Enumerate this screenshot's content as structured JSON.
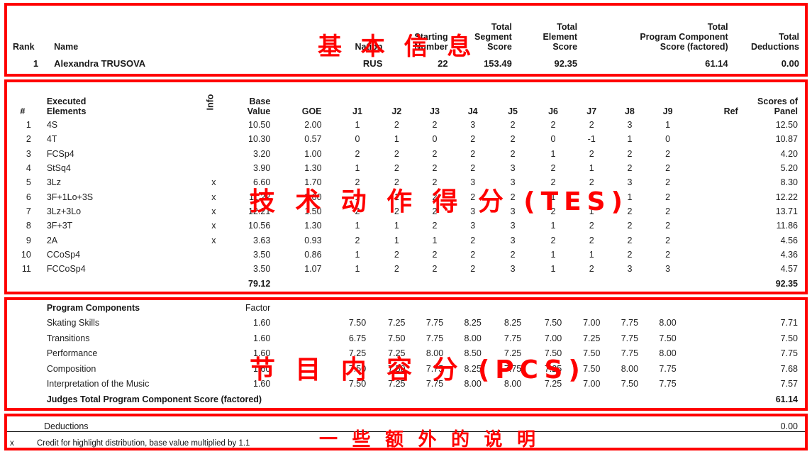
{
  "info": {
    "columns": {
      "rank": "Rank",
      "name": "Name",
      "nation": "Nation",
      "starting_number": [
        "Starting",
        "Number"
      ],
      "total_segment_score": [
        "Total",
        "Segment",
        "Score"
      ],
      "total_element_score": [
        "Total",
        "Element",
        "Score"
      ],
      "total_program_component_score": [
        "Total",
        "Program  Component",
        "Score (factored)"
      ],
      "total_deductions": [
        "Total",
        "Deductions"
      ]
    },
    "skater": {
      "rank": "1",
      "name": "Alexandra TRUSOVA",
      "nation": "RUS",
      "starting_number": "22",
      "total_segment_score": "153.49",
      "total_element_score": "92.35",
      "total_program_component_score": "61.14",
      "total_deductions": "0.00"
    }
  },
  "elements": {
    "columns": {
      "num": "#",
      "executed_elements": [
        "Executed",
        "Elements"
      ],
      "info": "Info",
      "base_value": [
        "Base",
        "Value"
      ],
      "goe": "GOE",
      "judges": [
        "J1",
        "J2",
        "J3",
        "J4",
        "J5",
        "J6",
        "J7",
        "J8",
        "J9"
      ],
      "ref": "Ref",
      "scores_of_panel": [
        "Scores of",
        "Panel"
      ]
    },
    "rows": [
      {
        "num": "1",
        "element": "4S",
        "info": "",
        "base_value": "10.50",
        "goe": "2.00",
        "judges": [
          "1",
          "2",
          "2",
          "3",
          "2",
          "2",
          "2",
          "3",
          "1"
        ],
        "ref": "",
        "score": "12.50"
      },
      {
        "num": "2",
        "element": "4T",
        "info": "",
        "base_value": "10.30",
        "goe": "0.57",
        "judges": [
          "0",
          "1",
          "0",
          "2",
          "2",
          "0",
          "-1",
          "1",
          "0"
        ],
        "ref": "",
        "score": "10.87"
      },
      {
        "num": "3",
        "element": "FCSp4",
        "info": "",
        "base_value": "3.20",
        "goe": "1.00",
        "judges": [
          "2",
          "2",
          "2",
          "2",
          "2",
          "1",
          "2",
          "2",
          "2"
        ],
        "ref": "",
        "score": "4.20"
      },
      {
        "num": "4",
        "element": "StSq4",
        "info": "",
        "base_value": "3.90",
        "goe": "1.30",
        "judges": [
          "1",
          "2",
          "2",
          "2",
          "3",
          "2",
          "1",
          "2",
          "2"
        ],
        "ref": "",
        "score": "5.20"
      },
      {
        "num": "5",
        "element": "3Lz",
        "info": "x",
        "base_value": "6.60",
        "goe": "1.70",
        "judges": [
          "2",
          "2",
          "2",
          "3",
          "3",
          "2",
          "2",
          "3",
          "2"
        ],
        "ref": "",
        "score": "8.30"
      },
      {
        "num": "6",
        "element": "3F+1Lo+3S",
        "info": "x",
        "base_value": "11.22",
        "goe": "2.00",
        "judges": [
          "1",
          "1",
          "2",
          "2",
          "2",
          "1",
          "2",
          "1",
          "2"
        ],
        "ref": "",
        "score": "12.22"
      },
      {
        "num": "7",
        "element": "3Lz+3Lo",
        "info": "x",
        "base_value": "12.21",
        "goe": "1.50",
        "judges": [
          "2",
          "2",
          "2",
          "3",
          "3",
          "2",
          "1",
          "2",
          "2"
        ],
        "ref": "",
        "score": "13.71"
      },
      {
        "num": "8",
        "element": "3F+3T",
        "info": "x",
        "base_value": "10.56",
        "goe": "1.30",
        "judges": [
          "1",
          "1",
          "2",
          "3",
          "3",
          "1",
          "2",
          "2",
          "2"
        ],
        "ref": "",
        "score": "11.86"
      },
      {
        "num": "9",
        "element": "2A",
        "info": "x",
        "base_value": "3.63",
        "goe": "0.93",
        "judges": [
          "2",
          "1",
          "1",
          "2",
          "3",
          "2",
          "2",
          "2",
          "2"
        ],
        "ref": "",
        "score": "4.56"
      },
      {
        "num": "10",
        "element": "CCoSp4",
        "info": "",
        "base_value": "3.50",
        "goe": "0.86",
        "judges": [
          "1",
          "2",
          "2",
          "2",
          "2",
          "1",
          "1",
          "2",
          "2"
        ],
        "ref": "",
        "score": "4.36"
      },
      {
        "num": "11",
        "element": "FCCoSp4",
        "info": "",
        "base_value": "3.50",
        "goe": "1.07",
        "judges": [
          "1",
          "2",
          "2",
          "2",
          "3",
          "1",
          "2",
          "3",
          "3"
        ],
        "ref": "",
        "score": "4.57"
      }
    ],
    "total_base_value": "79.12",
    "total_score": "92.35"
  },
  "components": {
    "title": "Program Components",
    "factor_label": "Factor",
    "rows": [
      {
        "name": "Skating Skills",
        "factor": "1.60",
        "judges": [
          "7.50",
          "7.25",
          "7.75",
          "8.25",
          "8.25",
          "7.50",
          "7.00",
          "7.75",
          "8.00"
        ],
        "score": "7.71"
      },
      {
        "name": "Transitions",
        "factor": "1.60",
        "judges": [
          "6.75",
          "7.50",
          "7.75",
          "8.00",
          "7.75",
          "7.00",
          "7.25",
          "7.75",
          "7.50"
        ],
        "score": "7.50"
      },
      {
        "name": "Performance",
        "factor": "1.60",
        "judges": [
          "7.25",
          "7.25",
          "8.00",
          "8.50",
          "7.25",
          "7.50",
          "7.50",
          "7.75",
          "8.00"
        ],
        "score": "7.75"
      },
      {
        "name": "Composition",
        "factor": "1.60",
        "judges": [
          "7.50",
          "7.50",
          "7.75",
          "8.25",
          "7.75",
          "7.25",
          "7.50",
          "8.00",
          "7.75"
        ],
        "score": "7.68"
      },
      {
        "name": "Interpretation of the Music",
        "factor": "1.60",
        "judges": [
          "7.50",
          "7.25",
          "7.75",
          "8.00",
          "8.00",
          "7.25",
          "7.00",
          "7.50",
          "7.75"
        ],
        "score": "7.57"
      }
    ],
    "total_label": "Judges Total Program Component Score (factored)",
    "total_value": "61.14"
  },
  "deductions": {
    "label": "Deductions",
    "value": "0.00"
  },
  "footnote": {
    "key": "x",
    "text": "Credit for highlight distribution, base value multiplied by 1.1"
  },
  "watermarks": {
    "info": "基 本 信 息",
    "tes": "技 术 动 作 得 分 (TES)",
    "pcs": "节 目 内 容 分 (PCS)",
    "note": "一 些 额 外 的 说 明"
  },
  "colors": {
    "frame_red": "#ff0000",
    "text": "#1a1a1a"
  }
}
